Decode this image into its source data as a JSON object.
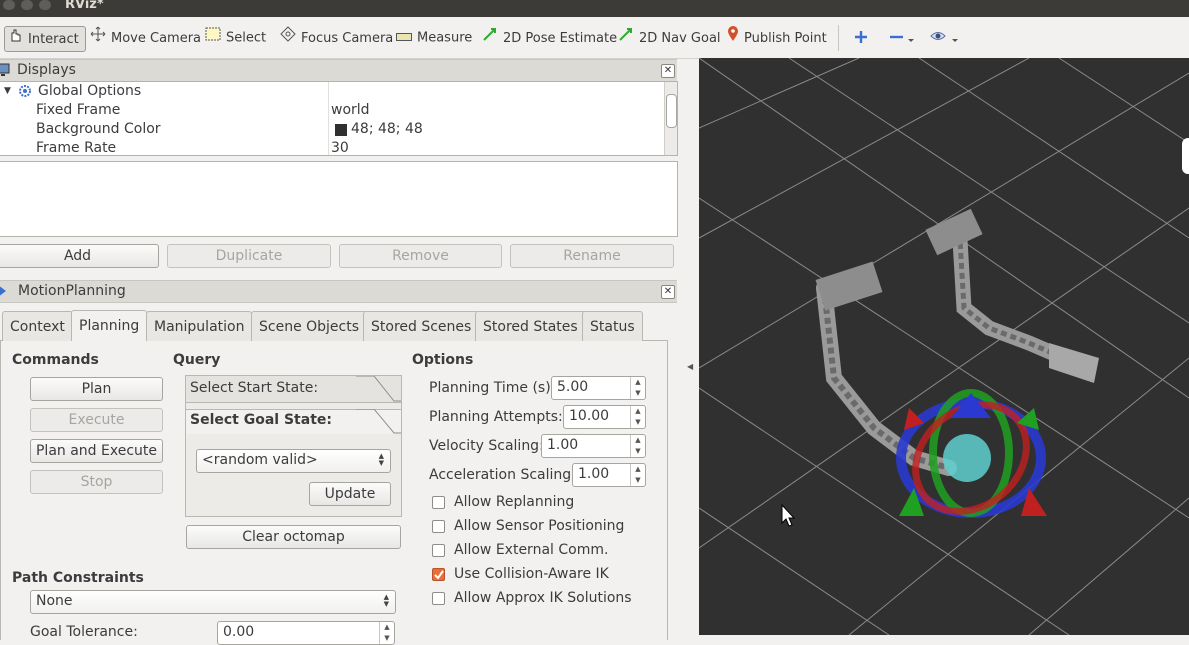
{
  "window": {
    "title": "RViz*"
  },
  "toolbar": {
    "tools": [
      {
        "label": "Interact",
        "icon": "hand-cursor-icon",
        "active": true
      },
      {
        "label": "Move Camera",
        "icon": "move-camera-icon"
      },
      {
        "label": "Select",
        "icon": "select-box-icon"
      },
      {
        "label": "Focus Camera",
        "icon": "focus-crosshair-icon"
      },
      {
        "label": "Measure",
        "icon": "ruler-icon"
      },
      {
        "label": "2D Pose Estimate",
        "icon": "green-arrow-icon"
      },
      {
        "label": "2D Nav Goal",
        "icon": "green-arrow-icon"
      },
      {
        "label": "Publish Point",
        "icon": "map-pin-icon"
      }
    ]
  },
  "displays": {
    "title": "Displays",
    "rows": [
      {
        "name": "Global Options",
        "value": ""
      },
      {
        "name": "Fixed Frame",
        "value": "world"
      },
      {
        "name": "Background Color",
        "value": "48; 48; 48"
      },
      {
        "name": "Frame Rate",
        "value": "30"
      }
    ],
    "buttons": {
      "add": "Add",
      "duplicate": "Duplicate",
      "remove": "Remove",
      "rename": "Rename"
    }
  },
  "motion_planning": {
    "title": "MotionPlanning",
    "tabs": [
      "Context",
      "Planning",
      "Manipulation",
      "Scene Objects",
      "Stored Scenes",
      "Stored States",
      "Status"
    ],
    "selected_tab": "Planning",
    "commands": {
      "title": "Commands",
      "plan": "Plan",
      "execute": "Execute",
      "plan_and_execute": "Plan and Execute",
      "stop": "Stop"
    },
    "query": {
      "title": "Query",
      "start_state": "Select Start State:",
      "goal_state": "Select Goal State:",
      "goal_value": "<random valid>",
      "update": "Update",
      "clear_octomap": "Clear octomap"
    },
    "options": {
      "title": "Options",
      "planning_time_label": "Planning Time (s):",
      "planning_time": "5.00",
      "planning_attempts_label": "Planning Attempts:",
      "planning_attempts": "10.00",
      "velocity_label": "Velocity Scaling:",
      "velocity": "1.00",
      "accel_label": "Acceleration Scaling:",
      "accel": "1.00",
      "checkboxes": [
        {
          "label": "Allow Replanning",
          "checked": false
        },
        {
          "label": "Allow Sensor Positioning",
          "checked": false
        },
        {
          "label": "Allow External Comm.",
          "checked": false
        },
        {
          "label": "Use Collision-Aware IK",
          "checked": true
        },
        {
          "label": "Allow Approx IK Solutions",
          "checked": false
        }
      ]
    },
    "path_constraints": {
      "title": "Path Constraints",
      "value": "None",
      "goal_tolerance_label": "Goal Tolerance:",
      "goal_tolerance": "0.00"
    }
  },
  "colors": {
    "viewport_bg": "#303030",
    "checkbox_on": "#e86f3a",
    "grid": "#8a8a8a"
  }
}
